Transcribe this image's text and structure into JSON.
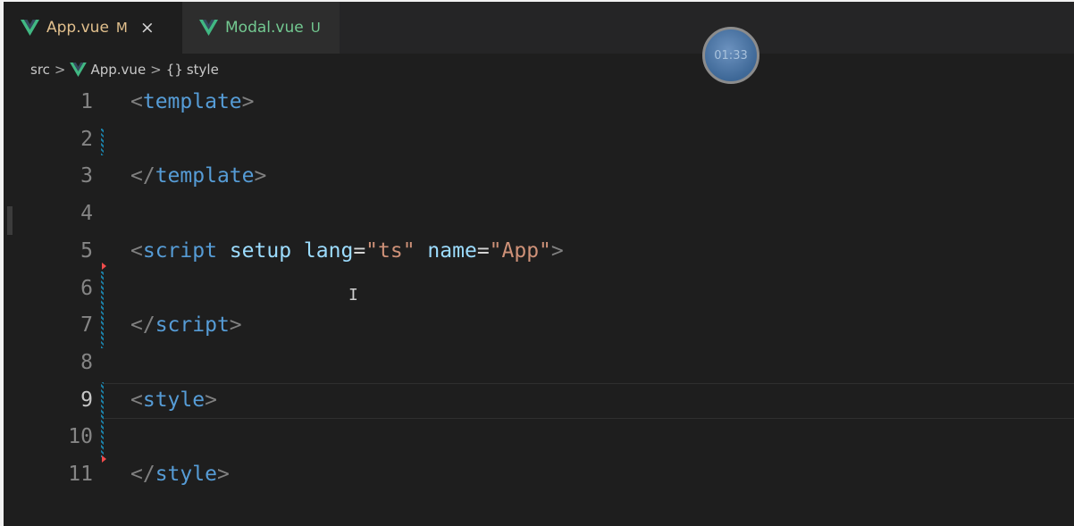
{
  "tabs": [
    {
      "name": "App.vue",
      "flag": "M",
      "close": "×"
    },
    {
      "name": "Modal.vue",
      "flag": "U"
    }
  ],
  "breadcrumb": {
    "root": "src",
    "sep": ">",
    "file": "App.vue",
    "symbol_icon": "{}",
    "symbol": "style"
  },
  "timer": "01:33",
  "lines": [
    {
      "n": "1",
      "tokens": [
        [
          "punc",
          "<"
        ],
        [
          "tag",
          "template"
        ],
        [
          "punc",
          ">"
        ]
      ]
    },
    {
      "n": "2",
      "tokens": []
    },
    {
      "n": "3",
      "tokens": [
        [
          "punc",
          "</"
        ],
        [
          "tag",
          "template"
        ],
        [
          "punc",
          ">"
        ]
      ]
    },
    {
      "n": "4",
      "tokens": []
    },
    {
      "n": "5",
      "tokens": [
        [
          "punc",
          "<"
        ],
        [
          "tag",
          "script"
        ],
        [
          "eq",
          " "
        ],
        [
          "attr",
          "setup"
        ],
        [
          "eq",
          " "
        ],
        [
          "attr",
          "lang"
        ],
        [
          "eq",
          "="
        ],
        [
          "str",
          "\"ts\""
        ],
        [
          "eq",
          " "
        ],
        [
          "attr",
          "name"
        ],
        [
          "eq",
          "="
        ],
        [
          "str",
          "\"App\""
        ],
        [
          "punc",
          ">"
        ]
      ]
    },
    {
      "n": "6",
      "tokens": []
    },
    {
      "n": "7",
      "tokens": [
        [
          "punc",
          "</"
        ],
        [
          "tag",
          "script"
        ],
        [
          "punc",
          ">"
        ]
      ]
    },
    {
      "n": "8",
      "tokens": []
    },
    {
      "n": "9",
      "tokens": [
        [
          "punc",
          "<"
        ],
        [
          "tag",
          "style"
        ],
        [
          "punc",
          ">"
        ]
      ]
    },
    {
      "n": "10",
      "tokens": []
    },
    {
      "n": "11",
      "tokens": [
        [
          "punc",
          "</"
        ],
        [
          "tag",
          "style"
        ],
        [
          "punc",
          ">"
        ]
      ]
    }
  ],
  "colors": {
    "accent_modified": "#e2c08d",
    "accent_untracked": "#73c991",
    "vue_green": "#41b883"
  },
  "icons": {
    "file_icon": "vue-logo-icon",
    "cursor": "text-cursor-icon"
  }
}
